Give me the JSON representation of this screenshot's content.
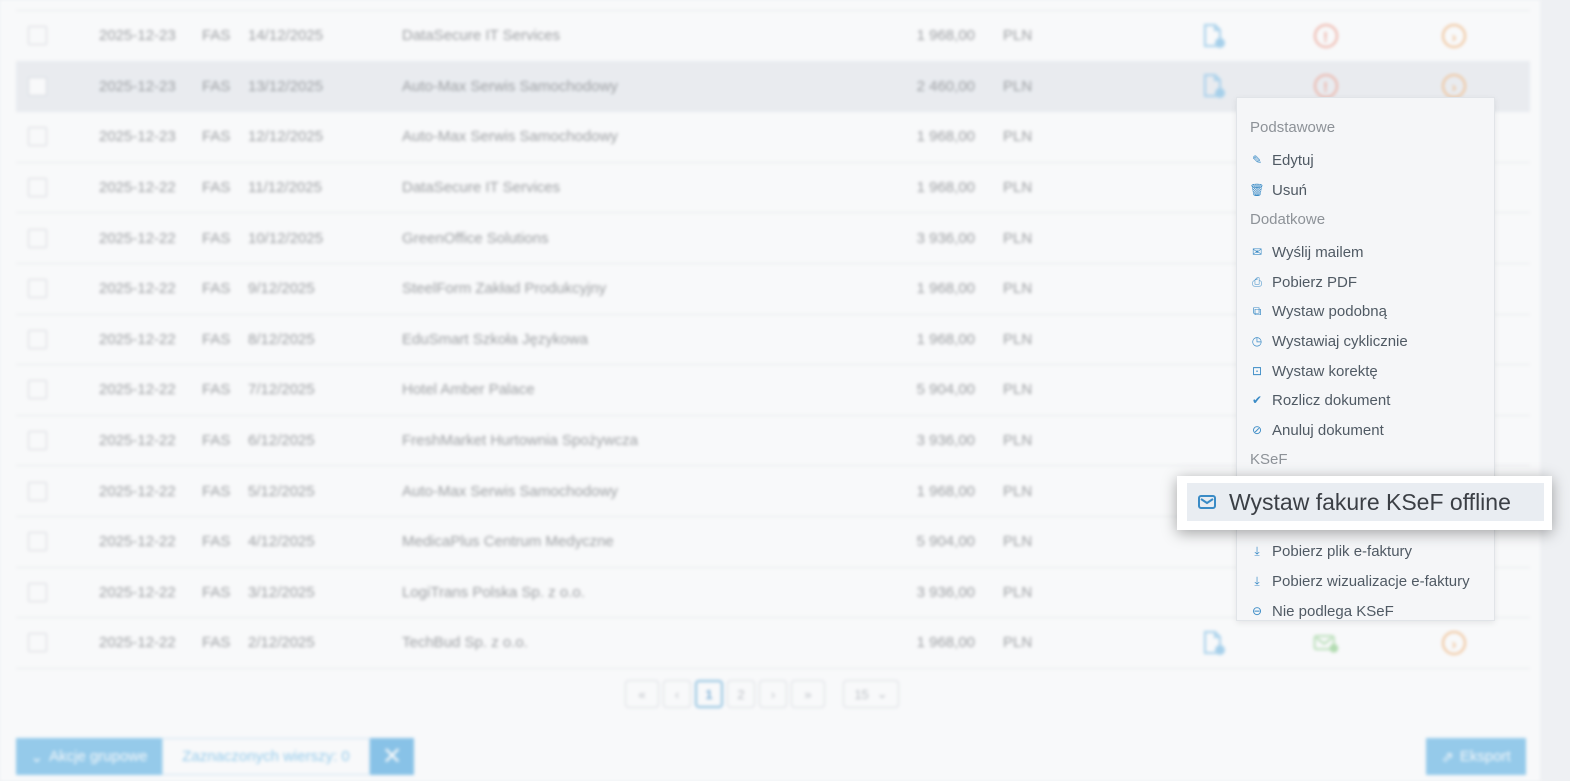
{
  "table": {
    "rows": [
      {
        "date": "2025-12-23",
        "type": "FAS",
        "number": "14/12/2025",
        "client": "DataSecure IT Services",
        "amount": "1 968,00",
        "currency": "PLN",
        "status": "red",
        "highlight": false
      },
      {
        "date": "2025-12-23",
        "type": "FAS",
        "number": "13/12/2025",
        "client": "Auto-Max Serwis Samochodowy",
        "amount": "2 460,00",
        "currency": "PLN",
        "status": "red",
        "highlight": true
      },
      {
        "date": "2025-12-23",
        "type": "FAS",
        "number": "12/12/2025",
        "client": "Auto-Max Serwis Samochodowy",
        "amount": "1 968,00",
        "currency": "PLN",
        "status": "none",
        "highlight": false
      },
      {
        "date": "2025-12-22",
        "type": "FAS",
        "number": "11/12/2025",
        "client": "DataSecure IT Services",
        "amount": "1 968,00",
        "currency": "PLN",
        "status": "none",
        "highlight": false
      },
      {
        "date": "2025-12-22",
        "type": "FAS",
        "number": "10/12/2025",
        "client": "GreenOffice Solutions",
        "amount": "3 936,00",
        "currency": "PLN",
        "status": "none",
        "highlight": false
      },
      {
        "date": "2025-12-22",
        "type": "FAS",
        "number": "9/12/2025",
        "client": "SteelForm Zakład Produkcyjny",
        "amount": "1 968,00",
        "currency": "PLN",
        "status": "none",
        "highlight": false
      },
      {
        "date": "2025-12-22",
        "type": "FAS",
        "number": "8/12/2025",
        "client": "EduSmart Szkoła Językowa",
        "amount": "1 968,00",
        "currency": "PLN",
        "status": "none",
        "highlight": false
      },
      {
        "date": "2025-12-22",
        "type": "FAS",
        "number": "7/12/2025",
        "client": "Hotel Amber Palace",
        "amount": "5 904,00",
        "currency": "PLN",
        "status": "none",
        "highlight": false
      },
      {
        "date": "2025-12-22",
        "type": "FAS",
        "number": "6/12/2025",
        "client": "FreshMarket Hurtownia Spożywcza",
        "amount": "3 936,00",
        "currency": "PLN",
        "status": "none",
        "highlight": false
      },
      {
        "date": "2025-12-22",
        "type": "FAS",
        "number": "5/12/2025",
        "client": "Auto-Max Serwis Samochodowy",
        "amount": "1 968,00",
        "currency": "PLN",
        "status": "none",
        "highlight": false
      },
      {
        "date": "2025-12-22",
        "type": "FAS",
        "number": "4/12/2025",
        "client": "MedicaPlus Centrum Medyczne",
        "amount": "5 904,00",
        "currency": "PLN",
        "status": "none",
        "highlight": false
      },
      {
        "date": "2025-12-22",
        "type": "FAS",
        "number": "3/12/2025",
        "client": "LogiTrans Polska Sp. z o.o.",
        "amount": "3 936,00",
        "currency": "PLN",
        "status": "none",
        "highlight": false
      },
      {
        "date": "2025-12-22",
        "type": "FAS",
        "number": "2/12/2025",
        "client": "TechBud Sp. z o.o.",
        "amount": "1 968,00",
        "currency": "PLN",
        "status": "green",
        "highlight": false
      }
    ]
  },
  "pagination": {
    "first": "«",
    "prev": "‹",
    "pages": [
      "1",
      "2"
    ],
    "next": "›",
    "last": "»",
    "page_size": "15"
  },
  "footer": {
    "bulk_actions": "Akcje grupowe",
    "selected_rows": "Zaznaczonych wierszy: 0",
    "clear": "✕",
    "export": "Eksport"
  },
  "menu": {
    "sections": [
      {
        "title": "Podstawowe",
        "items": [
          {
            "label": "Edytuj",
            "icon": "pencil-icon"
          },
          {
            "label": "Usuń",
            "icon": "trash-icon"
          }
        ]
      },
      {
        "title": "Dodatkowe",
        "items": [
          {
            "label": "Wyślij mailem",
            "icon": "envelope-icon"
          },
          {
            "label": "Pobierz PDF",
            "icon": "printer-icon"
          },
          {
            "label": "Wystaw podobną",
            "icon": "copy-icon"
          },
          {
            "label": "Wystawiaj cyklicznie",
            "icon": "clock-icon"
          },
          {
            "label": "Wystaw korektę",
            "icon": "correction-icon"
          },
          {
            "label": "Rozlicz dokument",
            "icon": "check-icon"
          },
          {
            "label": "Anuluj dokument",
            "icon": "ban-icon"
          }
        ]
      },
      {
        "title": "KSeF",
        "items": [
          {
            "label": "Pobierz plik e-faktury",
            "icon": "download-icon"
          },
          {
            "label": "Pobierz wizualizacje e-faktury",
            "icon": "download-icon"
          },
          {
            "label": "Nie podlega KSeF",
            "icon": "minus-circle-icon"
          }
        ]
      }
    ],
    "highlight": {
      "label": "Wystaw fakure KSeF offline",
      "icon": "envelope-icon"
    }
  },
  "colors": {
    "accent": "#3a8bc6",
    "button": "#5fb4e6"
  }
}
